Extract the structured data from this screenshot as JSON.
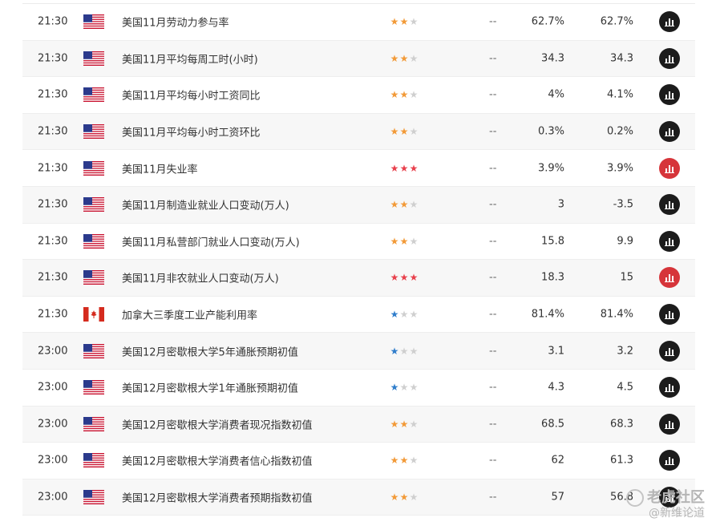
{
  "colors": {
    "star_orange": "#f29a38",
    "star_red": "#e8404c",
    "star_blue": "#2f7dcb",
    "star_empty": "#cfcfcf",
    "chart_button_dark": "#1c1c1c",
    "chart_button_red": "#d6353a"
  },
  "rows": [
    {
      "time": "21:30",
      "flag": "us-flag-icon",
      "event": "美国11月劳动力参与率",
      "importance": 2,
      "star_color": "orange",
      "prev": "--",
      "forecast": "62.7%",
      "actual": "62.7%",
      "chart_color": "dark"
    },
    {
      "time": "21:30",
      "flag": "us-flag-icon",
      "event": "美国11月平均每周工时(小时)",
      "importance": 2,
      "star_color": "orange",
      "prev": "--",
      "forecast": "34.3",
      "actual": "34.3",
      "chart_color": "dark"
    },
    {
      "time": "21:30",
      "flag": "us-flag-icon",
      "event": "美国11月平均每小时工资同比",
      "importance": 2,
      "star_color": "orange",
      "prev": "--",
      "forecast": "4%",
      "actual": "4.1%",
      "chart_color": "dark"
    },
    {
      "time": "21:30",
      "flag": "us-flag-icon",
      "event": "美国11月平均每小时工资环比",
      "importance": 2,
      "star_color": "orange",
      "prev": "--",
      "forecast": "0.3%",
      "actual": "0.2%",
      "chart_color": "dark"
    },
    {
      "time": "21:30",
      "flag": "us-flag-icon",
      "event": "美国11月失业率",
      "importance": 3,
      "star_color": "red",
      "prev": "--",
      "forecast": "3.9%",
      "actual": "3.9%",
      "chart_color": "red"
    },
    {
      "time": "21:30",
      "flag": "us-flag-icon",
      "event": "美国11月制造业就业人口变动(万人)",
      "importance": 2,
      "star_color": "orange",
      "prev": "--",
      "forecast": "3",
      "actual": "-3.5",
      "chart_color": "dark"
    },
    {
      "time": "21:30",
      "flag": "us-flag-icon",
      "event": "美国11月私营部门就业人口变动(万人)",
      "importance": 2,
      "star_color": "orange",
      "prev": "--",
      "forecast": "15.8",
      "actual": "9.9",
      "chart_color": "dark"
    },
    {
      "time": "21:30",
      "flag": "us-flag-icon",
      "event": "美国11月非农就业人口变动(万人)",
      "importance": 3,
      "star_color": "red",
      "prev": "--",
      "forecast": "18.3",
      "actual": "15",
      "chart_color": "red"
    },
    {
      "time": "21:30",
      "flag": "canada-flag-icon",
      "event": "加拿大三季度工业产能利用率",
      "importance": 1,
      "star_color": "blue",
      "prev": "--",
      "forecast": "81.4%",
      "actual": "81.4%",
      "chart_color": "dark"
    },
    {
      "time": "23:00",
      "flag": "us-flag-icon",
      "event": "美国12月密歇根大学5年通胀预期初值",
      "importance": 1,
      "star_color": "blue",
      "prev": "--",
      "forecast": "3.1",
      "actual": "3.2",
      "chart_color": "dark"
    },
    {
      "time": "23:00",
      "flag": "us-flag-icon",
      "event": "美国12月密歇根大学1年通胀预期初值",
      "importance": 1,
      "star_color": "blue",
      "prev": "--",
      "forecast": "4.3",
      "actual": "4.5",
      "chart_color": "dark"
    },
    {
      "time": "23:00",
      "flag": "us-flag-icon",
      "event": "美国12月密歇根大学消费者现况指数初值",
      "importance": 2,
      "star_color": "orange",
      "prev": "--",
      "forecast": "68.5",
      "actual": "68.3",
      "chart_color": "dark"
    },
    {
      "time": "23:00",
      "flag": "us-flag-icon",
      "event": "美国12月密歇根大学消费者信心指数初值",
      "importance": 2,
      "star_color": "orange",
      "prev": "--",
      "forecast": "62",
      "actual": "61.3",
      "chart_color": "dark"
    },
    {
      "time": "23:00",
      "flag": "us-flag-icon",
      "event": "美国12月密歇根大学消费者预期指数初值",
      "importance": 2,
      "star_color": "orange",
      "prev": "--",
      "forecast": "57",
      "actual": "56.8",
      "chart_color": "dark"
    }
  ],
  "watermark": {
    "top": "老虎社区",
    "bottom": "@新维论道"
  }
}
